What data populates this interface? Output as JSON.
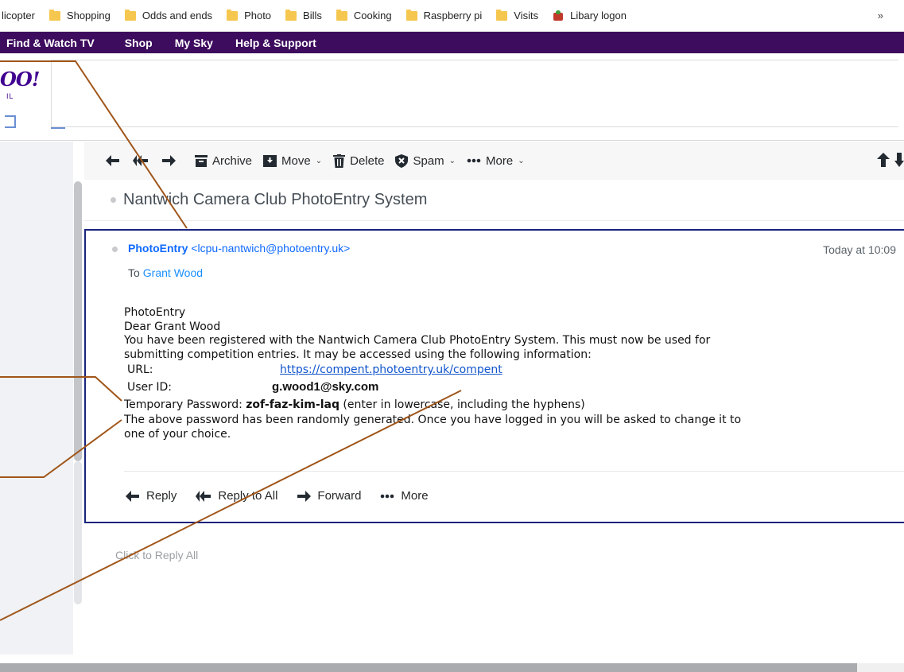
{
  "bookmarks": {
    "items": [
      "licopter",
      "Shopping",
      "Odds and ends",
      "Photo",
      "Bills",
      "Cooking",
      "Raspberry pi",
      "Visits",
      "Libary logon"
    ],
    "overflow": "»"
  },
  "sky_nav": {
    "items": [
      "Find & Watch TV",
      "Shop",
      "My Sky",
      "Help & Support"
    ]
  },
  "yahoo": {
    "logo": "OO!",
    "logo_sub": "IL"
  },
  "toolbar": {
    "archive": "Archive",
    "move": "Move",
    "delete": "Delete",
    "spam": "Spam",
    "more": "More",
    "chevron": "⌄"
  },
  "message": {
    "subject": "Nantwich Camera Club PhotoEntry System",
    "sender_name": "PhotoEntry",
    "sender_address": "<lcpu-nantwich@photoentry.uk>",
    "time": "Today at 10:09",
    "to_label": "To",
    "to_name": "Grant Wood",
    "body": {
      "line1": "PhotoEntry",
      "line2": "Dear Grant Wood",
      "line3": "You have been registered with the Nantwich Camera Club PhotoEntry System. This must now be used for",
      "line4": "submitting competition entries. It may be accessed using the following information:",
      "url_label": "URL:",
      "url_value": "https://compent.photoentry.uk/compent",
      "user_label": "User ID:",
      "user_value": "g.wood1@sky.com",
      "pw_label": "Temporary Password:",
      "pw_value": "zof-faz-kim-laq",
      "pw_note": "(enter in lowercase, including the hyphens)",
      "line5": "The above password has been randomly generated. Once you have logged in you will be asked to change it to",
      "line6": "one of your choice."
    },
    "actions": {
      "reply": "Reply",
      "reply_all": "Reply to All",
      "forward": "Forward",
      "more": "More"
    }
  },
  "click_to_reply_all": "Click to Reply All",
  "colors": {
    "sky_purple": "#3d0c5e",
    "yahoo_purple": "#400090",
    "link_blue": "#0f69ff",
    "card_border": "#1a237e",
    "annotation": "#a0561a"
  }
}
